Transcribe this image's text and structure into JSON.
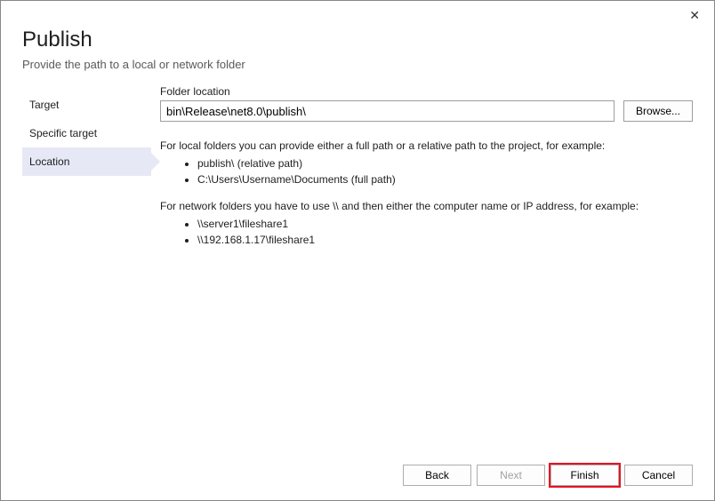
{
  "close": "✕",
  "header": {
    "title": "Publish",
    "subtitle": "Provide the path to a local or network folder"
  },
  "sidebar": {
    "items": [
      {
        "label": "Target"
      },
      {
        "label": "Specific target"
      },
      {
        "label": "Location"
      }
    ]
  },
  "content": {
    "folder_label": "Folder location",
    "folder_value": "bin\\Release\\net8.0\\publish\\",
    "browse_label": "Browse...",
    "help_local_intro": "For local folders you can provide either a full path or a relative path to the project, for example:",
    "help_local_ex1": "publish\\ (relative path)",
    "help_local_ex2": "C:\\Users\\Username\\Documents (full path)",
    "help_network_intro": "For network folders you have to use \\\\ and then either the computer name or IP address, for example:",
    "help_network_ex1": "\\\\server1\\fileshare1",
    "help_network_ex2": "\\\\192.168.1.17\\fileshare1"
  },
  "footer": {
    "back": "Back",
    "next": "Next",
    "finish": "Finish",
    "cancel": "Cancel"
  }
}
